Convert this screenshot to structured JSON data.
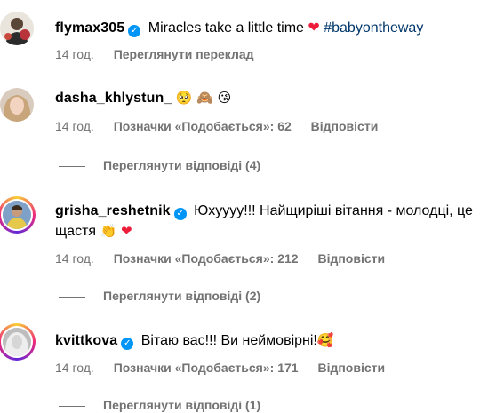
{
  "comments": [
    {
      "username": "flymax305",
      "verified": true,
      "text": "Miracles take a little time",
      "emoji": "❤",
      "hashtag": "#babyontheway",
      "time": "14 год.",
      "translate": "Переглянути переклад"
    },
    {
      "username": "dasha_khlystun_",
      "verified": false,
      "emoji": "🥺 🙈 😘",
      "time": "14 год.",
      "likes_label": "Позначки «Подобається»: 62",
      "reply": "Відповісти",
      "view_replies": "Переглянути відповіді (4)"
    },
    {
      "username": "grisha_reshetnik",
      "verified": true,
      "text": "Юхуууу!!! Найщиріші вітання - молодці, це",
      "text2": "щастя",
      "emoji": "👏 ❤",
      "time": "14 год.",
      "likes_label": "Позначки «Подобається»: 212",
      "reply": "Відповісти",
      "view_replies": "Переглянути відповіді (2)"
    },
    {
      "username": "kvittkova",
      "verified": true,
      "text": "Вітаю вас!!! Ви неймовірні!",
      "emoji": "🥰",
      "time": "14 год.",
      "likes_label": "Позначки «Подобається»: 171",
      "reply": "Відповісти",
      "view_replies": "Переглянути відповіді (1)"
    }
  ],
  "colors": {
    "verified": "#0095f6",
    "muted": "#737373",
    "hashtag": "#00376b",
    "heart": "#ed1c3b"
  }
}
